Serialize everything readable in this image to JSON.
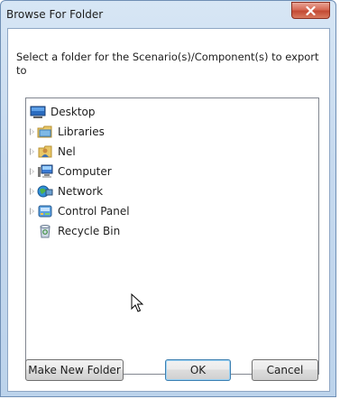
{
  "window": {
    "title": "Browse For Folder"
  },
  "instruction": "Select a folder for the Scenario(s)/Component(s) to export to",
  "tree": {
    "items": [
      {
        "label": "Desktop",
        "icon": "desktop-icon",
        "expandable": false
      },
      {
        "label": "Libraries",
        "icon": "libraries-folder-icon",
        "expandable": true
      },
      {
        "label": "Nel",
        "icon": "user-folder-icon",
        "expandable": true
      },
      {
        "label": "Computer",
        "icon": "computer-icon",
        "expandable": true
      },
      {
        "label": "Network",
        "icon": "network-icon",
        "expandable": true
      },
      {
        "label": "Control Panel",
        "icon": "control-panel-icon",
        "expandable": true
      },
      {
        "label": "Recycle Bin",
        "icon": "recycle-bin-icon",
        "expandable": false
      }
    ]
  },
  "buttons": {
    "make_new_folder": "Make New Folder",
    "ok": "OK",
    "cancel": "Cancel"
  },
  "colors": {
    "frame": "#c6d9ee",
    "close_button": "#c34a33",
    "ok_focus": "#3c7fb1"
  }
}
